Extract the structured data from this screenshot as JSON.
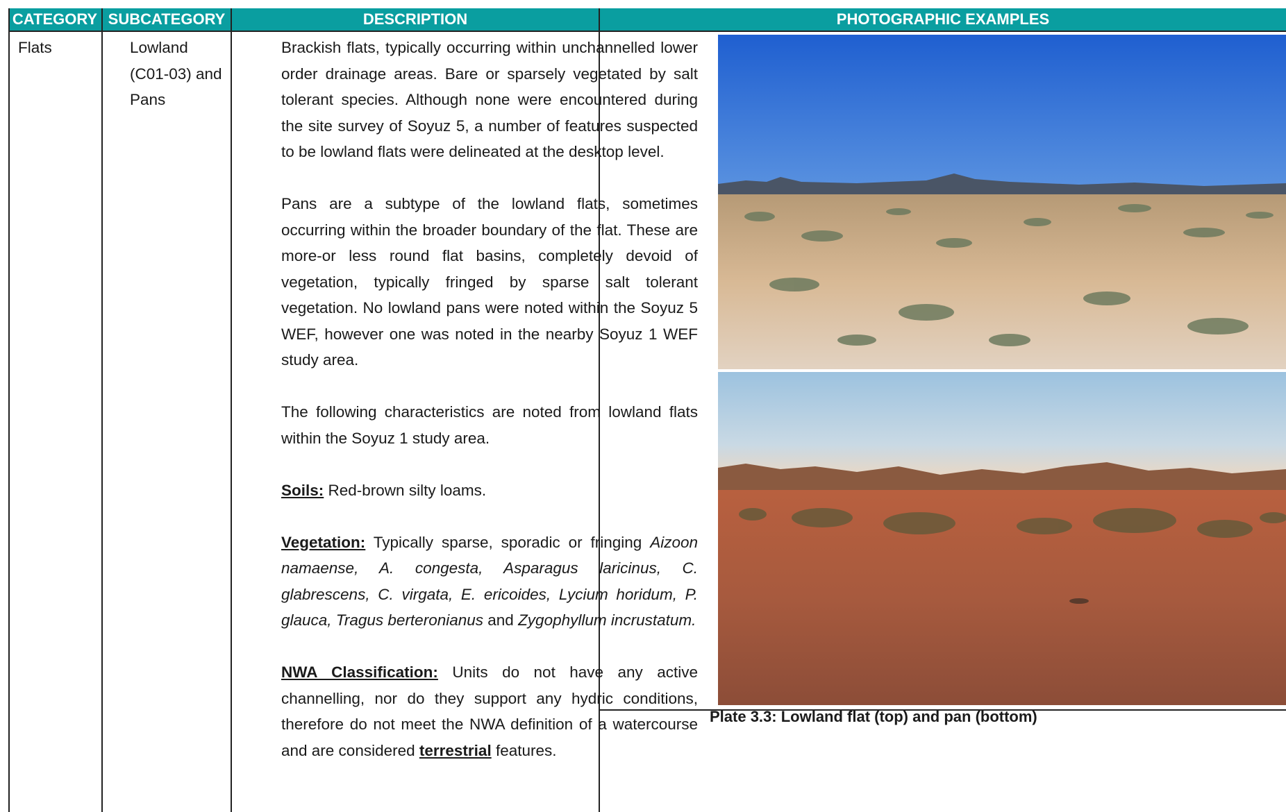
{
  "headers": {
    "category": "CATEGORY",
    "subcategory": "SUBCATEGORY",
    "description": "DESCRIPTION",
    "photos": "PHOTOGRAPHIC EXAMPLES"
  },
  "row": {
    "category": "Flats",
    "subcategory_lines": [
      "Lowland",
      "(C01-03) and",
      "Pans"
    ],
    "desc_p1": "Brackish flats, typically occurring within unchannelled lower order drainage areas. Bare or sparsely vegetated by salt tolerant species. Although none were encountered during the site survey of Soyuz 5, a number of features suspected to be lowland flats were delineated at the desktop level.",
    "desc_p2": "Pans are a subtype of the lowland flats, sometimes occurring within the broader boundary of the flat. These are more-or less round flat basins, completely devoid of vegetation, typically fringed by sparse salt tolerant vegetation. No lowland pans were noted within the Soyuz 5 WEF, however one was noted in the nearby Soyuz 1 WEF study area.",
    "desc_p3": "The following characteristics are noted from lowland flats within the Soyuz 1 study area.",
    "soils_label": "Soils:",
    "soils_text": " Red-brown silty loams.",
    "veg_label": "Vegetation:",
    "veg_text_plain": " Typically sparse, sporadic or fringing ",
    "veg_species": "Aizoon namaense, A. congesta, Asparagus laricinus, C. glabrescens, C. virgata, E. ericoides, Lycium horidum, P. glauca, Tragus berteronianus",
    "veg_and": " and ",
    "veg_last": "Zygophyllum incrustatum.",
    "nwa_label": "NWA Classification:",
    "nwa_text": " Units do not have any active channelling, nor do they support any hydric conditions, therefore do not meet the NWA definition of a watercourse and are considered ",
    "nwa_bold": "terrestrial",
    "nwa_end": " features."
  },
  "caption": "Plate 3.3: Lowland flat (top) and pan (bottom)",
  "colors": {
    "header_bg": "#0a9ea0",
    "header_text": "#ffffff"
  }
}
